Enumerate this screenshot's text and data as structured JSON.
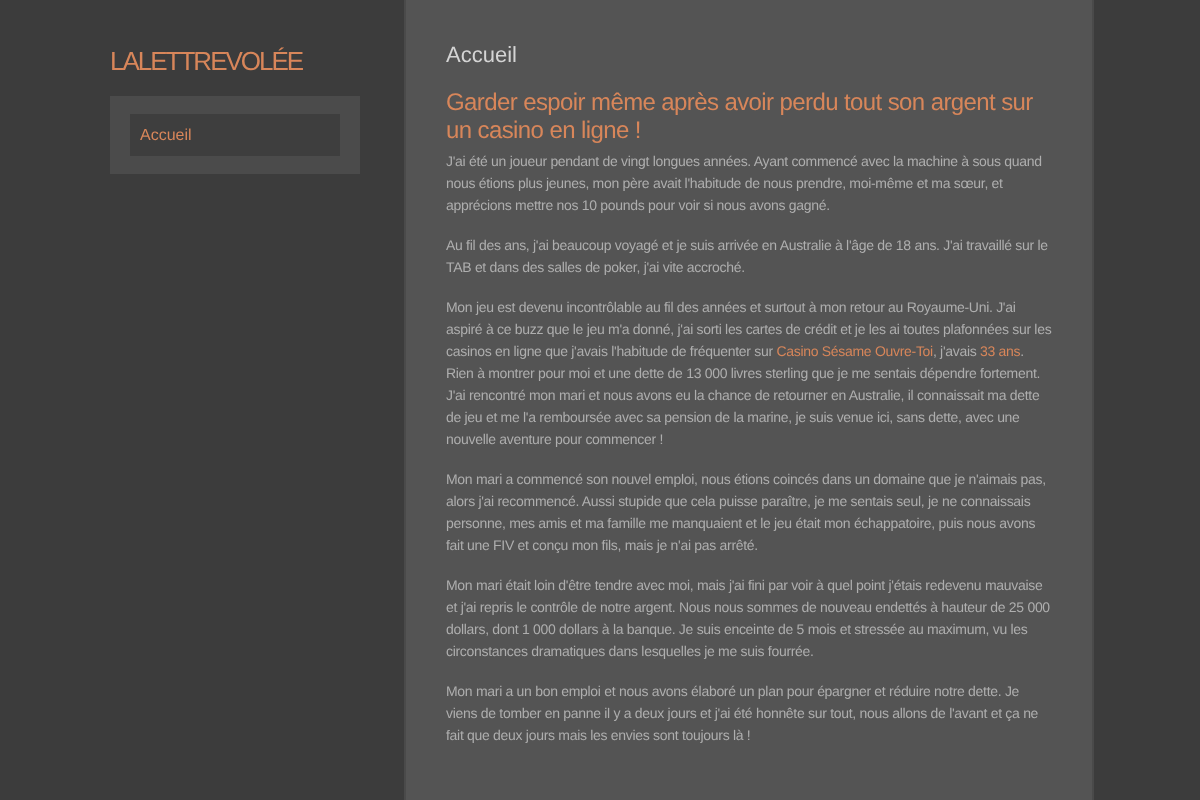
{
  "site": {
    "logo": "LALETTREVOLÉE"
  },
  "nav": {
    "items": [
      {
        "label": "Accueil",
        "selected": true
      }
    ]
  },
  "page": {
    "title": "Accueil",
    "heading": "Garder espoir même après avoir perdu tout son argent sur un casino en ligne !",
    "paragraphs": [
      [
        {
          "kind": "text",
          "text": "J'ai été un joueur pendant de vingt longues années. Ayant commencé avec la machine à sous quand nous étions plus jeunes, mon père avait l'habitude de nous prendre, moi-même et ma sœur, et apprécions mettre nos 10 pounds pour voir si nous avons gagné."
        }
      ],
      [
        {
          "kind": "text",
          "text": "Au fil des ans, j'ai beaucoup voyagé et je suis arrivée en Australie à l'âge de 18 ans. J'ai travaillé sur le TAB et dans des salles de poker, j'ai vite accroché."
        }
      ],
      [
        {
          "kind": "text",
          "text": "Mon jeu est devenu incontrôlable au fil des années et surtout à mon retour au Royaume-Uni. J'ai aspiré à ce buzz que le jeu m'a donné, j'ai sorti les cartes de crédit et je les ai toutes plafonnées sur les casinos en ligne que j'avais l'habitude de fréquenter sur "
        },
        {
          "kind": "link",
          "text": "Casino Sésame Ouvre-Toi"
        },
        {
          "kind": "text",
          "text": ", j'avais "
        },
        {
          "kind": "link",
          "text": "33 ans"
        },
        {
          "kind": "text",
          "text": ". Rien à montrer pour moi et une dette de 13 000 livres sterling que je me sentais dépendre fortement. J'ai rencontré mon mari et nous avons eu la chance de retourner en Australie, il connaissait ma dette de jeu et me l'a remboursée avec sa pension de la marine, je suis venue ici, sans dette, avec une nouvelle aventure pour commencer !"
        }
      ],
      [
        {
          "kind": "text",
          "text": "Mon mari a commencé son nouvel emploi, nous étions coincés dans un domaine que je n'aimais pas, alors j'ai recommencé. Aussi stupide que cela puisse paraître, je me sentais seul, je ne connaissais personne, mes amis et ma famille me manquaient et le jeu était mon échappatoire, puis nous avons fait une FIV et conçu mon fils, mais je n'ai pas arrêté."
        }
      ],
      [
        {
          "kind": "text",
          "text": "Mon mari était loin d'être tendre avec moi, mais j'ai fini par voir à quel point j'étais redevenu mauvaise et j'ai repris le contrôle de notre argent. Nous nous sommes de nouveau endettés à hauteur de 25 000 dollars, dont 1 000 dollars à la banque. Je suis enceinte de 5 mois et stressée au maximum, vu les circonstances dramatiques dans lesquelles je me suis fourrée."
        }
      ],
      [
        {
          "kind": "text",
          "text": "Mon mari a un bon emploi et nous avons élaboré un plan pour épargner et réduire notre dette. Je viens de tomber en panne il y a deux jours et j'ai été honnête sur tout, nous allons de l'avant et ça ne fait que deux jours mais les envies sont toujours là !"
        }
      ]
    ]
  }
}
